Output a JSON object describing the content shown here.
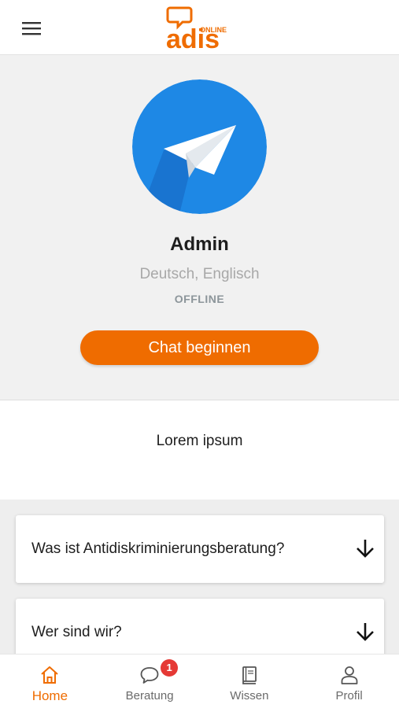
{
  "header": {
    "menu_icon": "menu-icon",
    "logo": {
      "brand": "adis",
      "tag": "ONLINE"
    },
    "brand_color": "#ef6c00"
  },
  "profile": {
    "avatar_icon": "paper-plane-icon",
    "avatar_color": "#1e88e5",
    "name": "Admin",
    "languages": "Deutsch, Englisch",
    "status": "OFFLINE",
    "chat_button": "Chat beginnen"
  },
  "intro": {
    "text": "Lorem ipsum"
  },
  "faq": {
    "items": [
      {
        "question": "Was ist Antidiskriminierungsberatung?",
        "icon": "arrow-down-icon"
      },
      {
        "question": "Wer sind wir?",
        "icon": "arrow-down-icon"
      }
    ]
  },
  "nav": {
    "items": [
      {
        "label": "Home",
        "icon": "home-icon",
        "active": true
      },
      {
        "label": "Beratung",
        "icon": "chat-bubble-icon",
        "badge": "1"
      },
      {
        "label": "Wissen",
        "icon": "book-icon"
      },
      {
        "label": "Profil",
        "icon": "person-icon"
      }
    ],
    "active_color": "#ef6c00",
    "badge_color": "#e53935"
  }
}
